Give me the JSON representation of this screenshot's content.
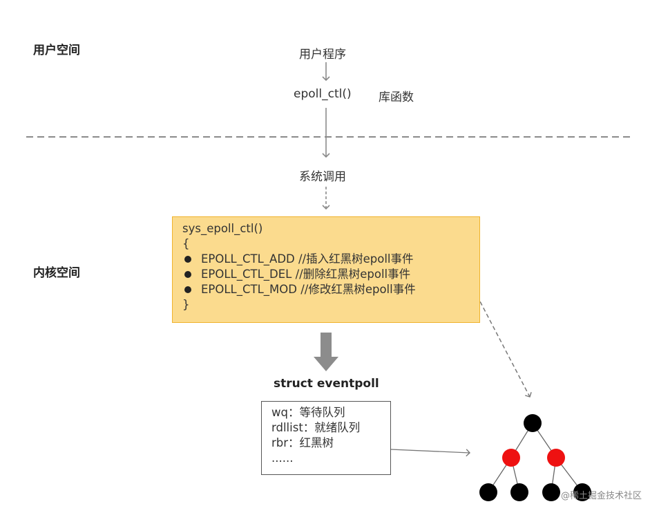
{
  "labels": {
    "user_space": "用户空间",
    "kernel_space": "内核空间"
  },
  "flow": {
    "user_program": "用户程序",
    "epoll_ctl": "epoll_ctl()",
    "library_function": "库函数",
    "system_call": "系统调用"
  },
  "ctl_box": {
    "signature": "sys_epoll_ctl()",
    "open_brace": "{",
    "items": [
      "EPOLL_CTL_ADD //插入红黑树epoll事件",
      "EPOLL_CTL_DEL  //删除红黑树epoll事件",
      "EPOLL_CTL_MOD //修改红黑树epoll事件"
    ],
    "close_brace": "}"
  },
  "struct": {
    "title": "struct eventpoll",
    "fields": [
      "wq：等待队列",
      "rdllist：就绪队列",
      "rbr：红黑树",
      "......"
    ]
  },
  "tree": {
    "node_colors": [
      "black",
      "red",
      "red",
      "black",
      "black",
      "black",
      "black"
    ]
  },
  "watermark": "@稀土掘金技术社区",
  "colors": {
    "box_fill": "#fbdb8e",
    "box_border": "#f0b32c",
    "red_node": "#ee1111",
    "black_node": "#000000",
    "arrow_gray": "#8a8a8a"
  }
}
